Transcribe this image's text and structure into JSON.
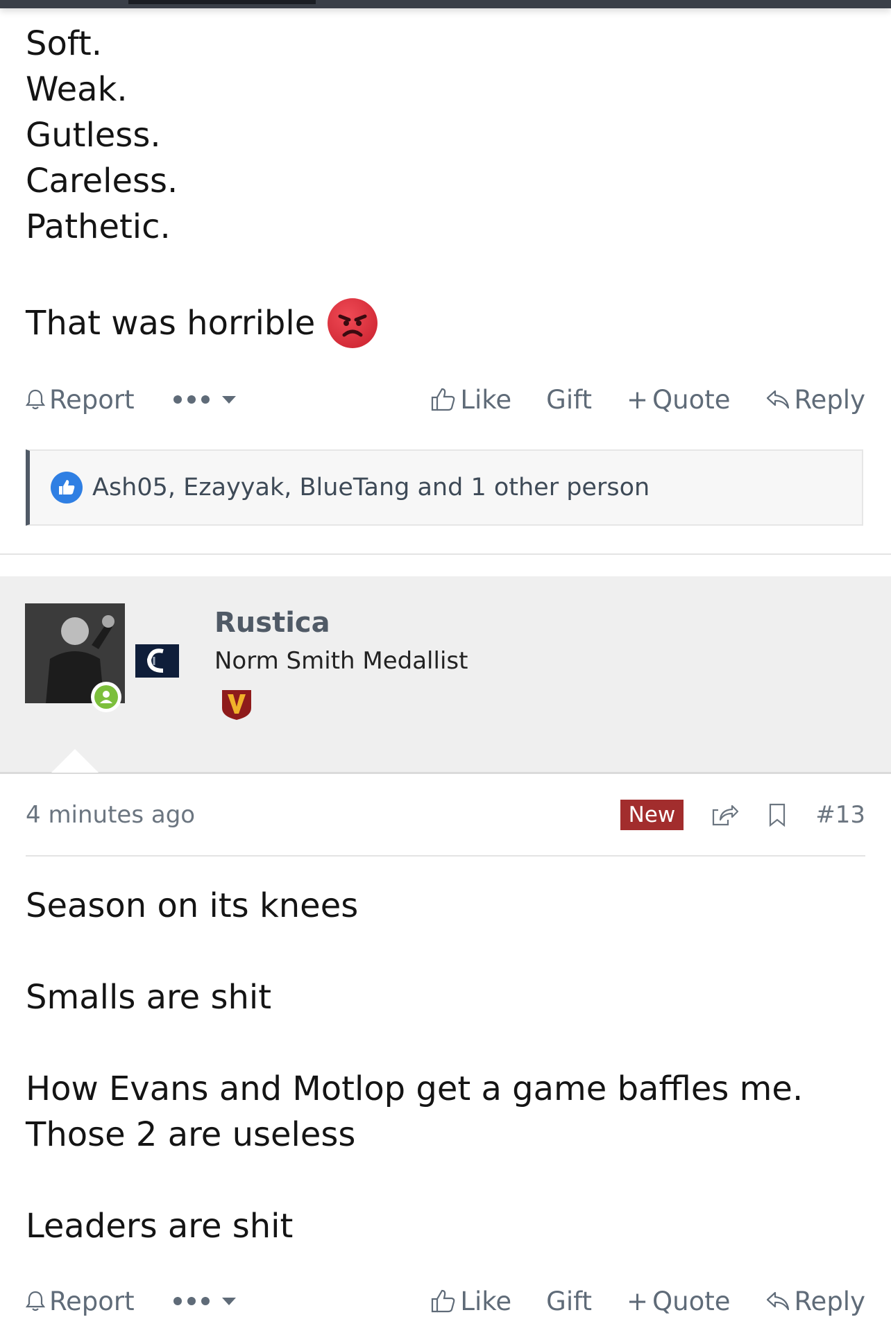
{
  "post1": {
    "lines": [
      "Soft.",
      "Weak.",
      "Gutless.",
      "Careless.",
      "Pathetic."
    ],
    "closing": "That was horrible",
    "emoji": "angry-face-emoji"
  },
  "actions": {
    "report": "Report",
    "like": "Like",
    "gift": "Gift",
    "quote": "Quote",
    "reply": "Reply"
  },
  "likes": {
    "text": "Ash05, Ezayyak, BlueTang and 1 other person"
  },
  "post2": {
    "user": {
      "name": "Rustica",
      "title": "Norm Smith Medallist",
      "badge": "V",
      "online": true
    },
    "time": "4 minutes ago",
    "new_label": "New",
    "post_number": "#13",
    "paragraphs": [
      [
        "Season on its knees"
      ],
      [
        "Smalls are shit"
      ],
      [
        "How Evans and Motlop get a game baffles me.",
        "Those 2 are useless"
      ],
      [
        "Leaders are shit"
      ]
    ]
  },
  "colors": {
    "accent": "#505a66",
    "new_badge": "#a22d2d",
    "online": "#7cbf3c",
    "like_blue": "#2f7fe3"
  }
}
